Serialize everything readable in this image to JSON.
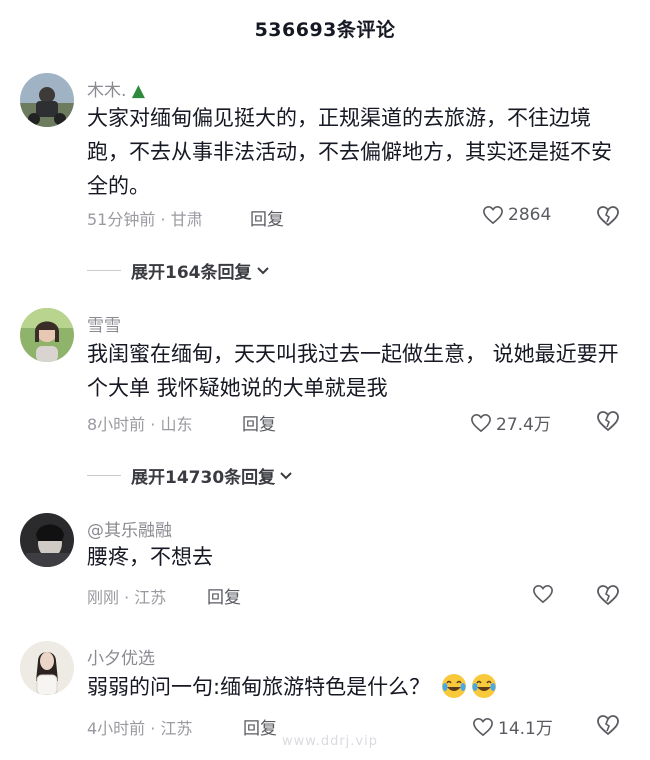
{
  "header": {
    "title": "536693条评论"
  },
  "comments": [
    {
      "username": "木木.",
      "username_badge_icon": "tree-emoji-icon",
      "text": "大家对缅甸偏见挺大的，正规渠道的去旅游，不往边境跑，不去从事非法活动，不去偏僻地方，其实还是挺不安全的。",
      "meta": "51分钟前 · 甘肃",
      "reply_label": "回复",
      "likes": "2864",
      "expand_label": "展开164条回复"
    },
    {
      "username": "雪雪",
      "text": "我闺蜜在缅甸，天天叫我过去一起做生意，  说她最近要开个大单  我怀疑她说的大单就是我",
      "meta": "8小时前 · 山东",
      "reply_label": "回复",
      "likes": "27.4万",
      "expand_label": "展开14730条回复"
    },
    {
      "username": "@其乐融融",
      "text": "腰疼，不想去",
      "meta": "刚刚 · 江苏",
      "reply_label": "回复",
      "likes": ""
    },
    {
      "username": "小夕优选",
      "text": "弱弱的问一句:缅甸旅游特色是什么？",
      "text_emojis": [
        "tears-of-joy-emoji-icon",
        "tears-of-joy-emoji-icon"
      ],
      "meta": "4小时前 · 江苏",
      "reply_label": "回复",
      "likes": "14.1万"
    }
  ],
  "watermark": "www.ddrj.vip",
  "colors": {
    "text": "#161823",
    "muted": "#9a9ba0",
    "username": "#8a8b91"
  }
}
